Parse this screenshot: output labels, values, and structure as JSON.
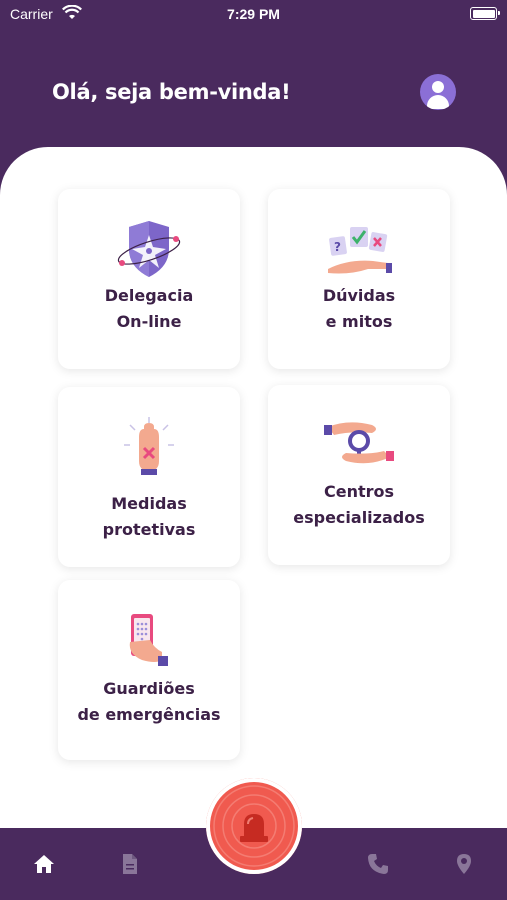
{
  "status_bar": {
    "carrier": "Carrier",
    "time": "7:29 PM"
  },
  "header": {
    "greeting": "Olá, seja bem-vinda!",
    "avatar_icon": "user-icon"
  },
  "cards": [
    {
      "lines": [
        "Delegacia",
        "On-line"
      ],
      "icon": "police-badge-icon"
    },
    {
      "lines": [
        "Dúvidas",
        "e mitos"
      ],
      "icon": "question-cards-icon"
    },
    {
      "lines": [
        "Medidas",
        "protetivas"
      ],
      "icon": "stop-hand-icon"
    },
    {
      "lines": [
        "Centros",
        "especializados"
      ],
      "icon": "female-symbol-hands-icon"
    },
    {
      "lines": [
        "Guardiões",
        "de emergências"
      ],
      "icon": "phone-hand-icon"
    }
  ],
  "tabbar": {
    "items": [
      "home-icon",
      "document-icon",
      "phone-icon",
      "location-pin-icon"
    ],
    "sos_icon": "siren-icon"
  },
  "colors": {
    "primary": "#4a2a5e",
    "accent": "#8b6fd6",
    "sos": "#f05a4f",
    "text": "#3c2147"
  }
}
